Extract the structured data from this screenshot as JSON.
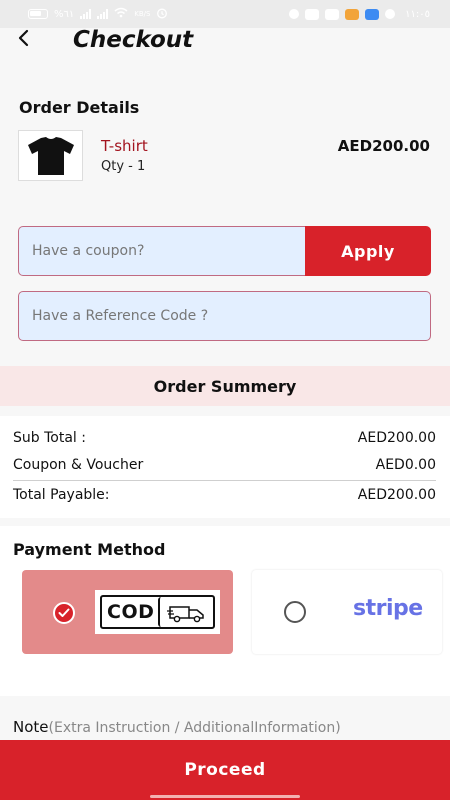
{
  "status_bar": {
    "battery_pct": "%٦١",
    "net_speed": "KB/S",
    "time": "١١:٠٥"
  },
  "header": {
    "title": "Checkout"
  },
  "order": {
    "heading": "Order Details",
    "item": {
      "name": "T-shirt",
      "qty_label": "Qty - ",
      "qty": "1",
      "price": "AED200.00"
    }
  },
  "coupon": {
    "placeholder": "Have a coupon?",
    "apply_label": "Apply"
  },
  "reference": {
    "placeholder": "Have a Reference Code ?"
  },
  "summary": {
    "heading": "Order Summery",
    "rows": [
      {
        "label": "Sub Total :",
        "value": "AED200.00"
      },
      {
        "label": "Coupon & Voucher",
        "value": "AED0.00"
      },
      {
        "label": "Total Payable:",
        "value": "AED200.00"
      }
    ]
  },
  "payment": {
    "heading": "Payment Method",
    "cod_label": "COD",
    "stripe_label": "stripe",
    "selected": "cod"
  },
  "note": {
    "label": "Note",
    "hint": "(Extra Instruction / AdditionalInformation)"
  },
  "footer": {
    "proceed_label": "Proceed"
  },
  "colors": {
    "accent": "#d8222a",
    "selected_card": "#e38a8a",
    "input_bg": "#e3efff",
    "stripe": "#6772e5",
    "summary_bar": "#f9e7e7"
  }
}
